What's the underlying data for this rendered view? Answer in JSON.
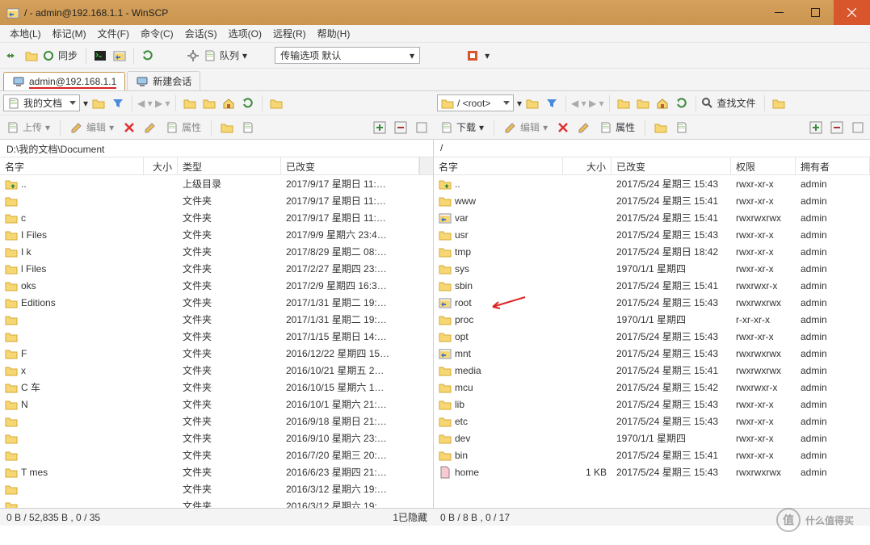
{
  "title": "/ - admin@192.168.1.1 - WinSCP",
  "menu": [
    "本地(L)",
    "标记(M)",
    "文件(F)",
    "命令(C)",
    "会话(S)",
    "选项(O)",
    "远程(R)",
    "帮助(H)"
  ],
  "toolbar": {
    "sync": "同步",
    "queue": "队列",
    "transfer": "传输选项 默认"
  },
  "session": {
    "active": "admin@192.168.1.1",
    "new": "新建会话"
  },
  "nav_left": {
    "path": "我的文档"
  },
  "nav_right": {
    "path": "/ <root>",
    "find": "查找文件"
  },
  "act_left": {
    "upload": "上传",
    "edit": "编辑",
    "prop": "属性"
  },
  "act_right": {
    "download": "下载",
    "edit": "编辑",
    "prop": "属性"
  },
  "left": {
    "pathbar": "D:\\我的文档\\Document",
    "cols": [
      "名字",
      "大小",
      "类型",
      "已改变"
    ],
    "rows": [
      [
        "..",
        "",
        "上级目录",
        "2017/9/17 星期日  11:…"
      ],
      [
        "",
        "",
        "文件夹",
        "2017/9/17 星期日  11:…"
      ],
      [
        "c",
        "",
        "文件夹",
        "2017/9/17 星期日  11:…"
      ],
      [
        "I             Files",
        "",
        "文件夹",
        "2017/9/9 星期六  23:4…"
      ],
      [
        "I             k",
        "",
        "文件夹",
        "2017/8/29 星期二  08:…"
      ],
      [
        "l             Files",
        "",
        "文件夹",
        "2017/2/27 星期四  23:…"
      ],
      [
        "              oks",
        "",
        "文件夹",
        "2017/2/9 星期四  16:3…"
      ],
      [
        "              Editions",
        "",
        "文件夹",
        "2017/1/31 星期二  19:…"
      ],
      [
        "",
        "",
        "文件夹",
        "2017/1/31 星期二  19:…"
      ],
      [
        "",
        "",
        "文件夹",
        "2017/1/15 星期日  14:…"
      ],
      [
        "F",
        "",
        "文件夹",
        "2016/12/22 星期四  15…"
      ],
      [
        "x",
        "",
        "文件夹",
        "2016/10/21 星期五  2…"
      ],
      [
        "C            车",
        "",
        "文件夹",
        "2016/10/15 星期六  1…"
      ],
      [
        "N",
        "",
        "文件夹",
        "2016/10/1 星期六  21:…"
      ],
      [
        "",
        "",
        "文件夹",
        "2016/9/18 星期日  21:…"
      ],
      [
        "",
        "",
        "文件夹",
        "2016/9/10 星期六  23:…"
      ],
      [
        "",
        "",
        "文件夹",
        "2016/7/20 星期三  20:…"
      ],
      [
        "T            mes",
        "",
        "文件夹",
        "2016/6/23 星期四  21:…"
      ],
      [
        "",
        "",
        "文件夹",
        "2016/3/12 星期六  19:…"
      ],
      [
        "",
        "",
        "文件夹",
        "2016/3/12 星期六  19:…"
      ]
    ]
  },
  "right": {
    "pathbar": "/",
    "cols": [
      "名字",
      "大小",
      "已改变",
      "权限",
      "拥有者"
    ],
    "rows": [
      [
        0,
        "..",
        "",
        "2017/5/24 星期三 15:43",
        "rwxr-xr-x",
        "admin"
      ],
      [
        1,
        "www",
        "",
        "2017/5/24 星期三 15:41",
        "rwxr-xr-x",
        "admin"
      ],
      [
        2,
        "var",
        "",
        "2017/5/24 星期三 15:41",
        "rwxrwxrwx",
        "admin"
      ],
      [
        1,
        "usr",
        "",
        "2017/5/24 星期三 15:43",
        "rwxr-xr-x",
        "admin"
      ],
      [
        1,
        "tmp",
        "",
        "2017/5/24 星期日 18:42",
        "rwxr-xr-x",
        "admin"
      ],
      [
        1,
        "sys",
        "",
        "1970/1/1 星期四",
        "rwxr-xr-x",
        "admin"
      ],
      [
        1,
        "sbin",
        "",
        "2017/5/24 星期三 15:41",
        "rwxrwxr-x",
        "admin"
      ],
      [
        2,
        "root",
        "",
        "2017/5/24 星期三 15:43",
        "rwxrwxrwx",
        "admin"
      ],
      [
        1,
        "proc",
        "",
        "1970/1/1 星期四",
        "r-xr-xr-x",
        "admin"
      ],
      [
        1,
        "opt",
        "",
        "2017/5/24 星期三 15:43",
        "rwxr-xr-x",
        "admin"
      ],
      [
        2,
        "mnt",
        "",
        "2017/5/24 星期三 15:43",
        "rwxrwxrwx",
        "admin"
      ],
      [
        1,
        "media",
        "",
        "2017/5/24 星期三 15:41",
        "rwxrwxrwx",
        "admin"
      ],
      [
        1,
        "mcu",
        "",
        "2017/5/24 星期三 15:42",
        "rwxrwxr-x",
        "admin"
      ],
      [
        1,
        "lib",
        "",
        "2017/5/24 星期三 15:43",
        "rwxr-xr-x",
        "admin"
      ],
      [
        1,
        "etc",
        "",
        "2017/5/24 星期三 15:43",
        "rwxr-xr-x",
        "admin"
      ],
      [
        1,
        "dev",
        "",
        "1970/1/1 星期四",
        "rwxr-xr-x",
        "admin"
      ],
      [
        1,
        "bin",
        "",
        "2017/5/24 星期三 15:41",
        "rwxr-xr-x",
        "admin"
      ],
      [
        3,
        "home",
        "1 KB",
        "2017/5/24 星期三 15:43",
        "rwxrwxrwx",
        "admin"
      ]
    ]
  },
  "status": {
    "left": "0 B / 52,835 B ,  0 / 35",
    "mid": "1已隐藏",
    "right": "0 B / 8 B ,  0 / 17"
  },
  "watermark": "什么值得买"
}
